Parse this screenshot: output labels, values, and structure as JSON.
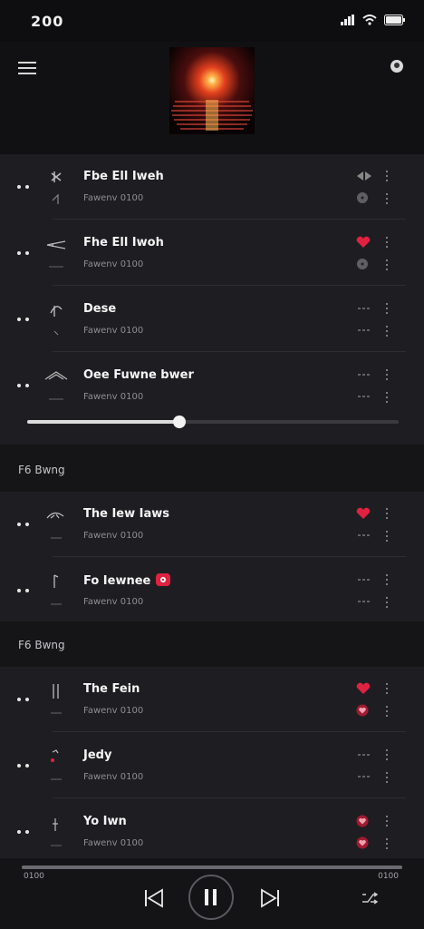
{
  "status_bar": {
    "time": "200"
  },
  "header": {
    "profile_label": ""
  },
  "player_seek": {
    "progress": 0.41
  },
  "sections": [
    {
      "label": "",
      "tracks": [
        {
          "title": "Fbe Ell Iweh",
          "meta": "Fawenv  0100",
          "icon_a": "play-icon",
          "icon_b": "disc-icon"
        },
        {
          "title": "Fhe Ell Iwoh",
          "meta": "Fawenv  0100",
          "icon_a": "heart-icon",
          "icon_b": "disc-icon"
        },
        {
          "title": "Dese",
          "meta": "Fawenv  0100",
          "icon_a": "dash-icon",
          "icon_b": "dash-icon"
        },
        {
          "title": "Oee Fuwne bwer",
          "meta": "Fawenv  0100",
          "icon_a": "dash-icon",
          "icon_b": "dash-icon"
        }
      ]
    },
    {
      "label": "F6 Bwng",
      "tracks": [
        {
          "title": "The Iew Iaws",
          "meta": "Fawenv  0100",
          "icon_a": "heart-icon",
          "icon_b": "dash-icon"
        },
        {
          "title": "Fo Iewnee",
          "meta": "Fawenv  0100",
          "icon_a": "dash-icon",
          "icon_b": "dash-icon",
          "badge": "flower-badge-icon"
        }
      ]
    },
    {
      "label": "F6 Bwng",
      "tracks": [
        {
          "title": "The Fein",
          "meta": "Fawenv  0100",
          "icon_a": "heart-icon",
          "icon_b": "heart-badge-icon"
        },
        {
          "title": "Jedy",
          "meta": "Fawenv  0100",
          "icon_a": "dash-icon",
          "icon_b": "dash-icon"
        },
        {
          "title": "Yo Iwn",
          "meta": "Fawenv  0100",
          "icon_a": "heart-badge-icon",
          "icon_b": "heart-badge-icon"
        }
      ]
    }
  ],
  "player": {
    "time_elapsed": "0100",
    "time_total": "0100",
    "progress": 1.0
  },
  "colors": {
    "accent": "#e0213f",
    "background": "#151517",
    "row_bg": "#1e1e22"
  }
}
